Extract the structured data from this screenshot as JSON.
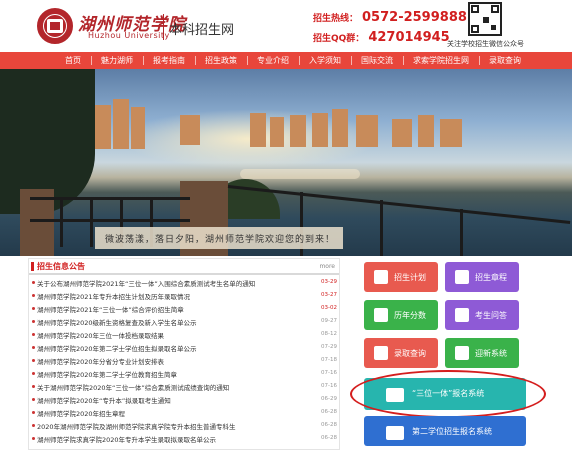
{
  "header": {
    "logo_cn": "湖州师范学院",
    "logo_en": "Huzhou University",
    "site_name": "本科招生网",
    "hotline_label": "招生热线：",
    "hotline_number": "0572-2599888",
    "qq_label": "招生QQ群：",
    "qq_number": "427014945",
    "qr_caption": "关注学校招生微信公众号"
  },
  "nav": {
    "items": [
      "首页",
      "魅力湖师",
      "报考指南",
      "招生政策",
      "专业介绍",
      "入学须知",
      "国际交流",
      "求索学院招生网",
      "录取查询"
    ]
  },
  "banner": {
    "caption": "微波荡漾，落日夕阳，湖州师范学院欢迎您的到来！"
  },
  "news": {
    "title": "招生信息公告",
    "more": "more",
    "items": [
      {
        "text": "关于公布湖州师范学院2021年“三位一体”入围综合素质测试考生名单的通知",
        "date": "03-29",
        "hot": true
      },
      {
        "text": "湖州师范学院2021年专升本招生计划及历年录取情况",
        "date": "03-27",
        "hot": true
      },
      {
        "text": "湖州师范学院2021年“三位一体”综合评价招生简章",
        "date": "03-02",
        "hot": true
      },
      {
        "text": "湖州师范学院2020级新生资格复查及新入学生名单公示",
        "date": "09-27",
        "hot": false
      },
      {
        "text": "湖州师范学院2020年三位一体投档录取结果",
        "date": "08-12",
        "hot": false
      },
      {
        "text": "湖州师范学院2020年第二学士学位招生拟录取名单公示",
        "date": "07-29",
        "hot": false
      },
      {
        "text": "湖州师范学院2020年分省分专业计划安排表",
        "date": "07-18",
        "hot": false
      },
      {
        "text": "湖州师范学院2020年第二学士学位教育招生简章",
        "date": "07-16",
        "hot": false
      },
      {
        "text": "关于湖州师范学院2020年“三位一体”综合素质测试成绩查询的通知",
        "date": "07-16",
        "hot": false
      },
      {
        "text": "湖州师范学院2020年“专升本”拟录取考生通知",
        "date": "06-29",
        "hot": false
      },
      {
        "text": "湖州师范学院2020年招生章程",
        "date": "06-28",
        "hot": false
      },
      {
        "text": "2020年湖州师范学院及湖州师范学院求真学院专升本招生普通专科生",
        "date": "06-28",
        "hot": false
      },
      {
        "text": "湖州师范学院求真学院2020年专升本学生录取拟录取名单公示",
        "date": "06-28",
        "hot": false
      }
    ]
  },
  "tiles": {
    "plan": "招生计划",
    "charter": "招生章程",
    "scores": "历年分数",
    "qa": "考生问答",
    "admission_query": "录取查询",
    "welcome_system": "迎新系统",
    "trinity_system": "“三位一体”报名系统",
    "second_degree_system": "第二学位招生报名系统"
  },
  "colors": {
    "brand_red": "#b3262b",
    "nav_red": "#e8463b",
    "tile_red": "#e85a4f",
    "tile_purple": "#8e5ad6",
    "tile_green": "#3ab24a",
    "tile_teal": "#27b5ae",
    "tile_blue": "#2f6fd1"
  }
}
